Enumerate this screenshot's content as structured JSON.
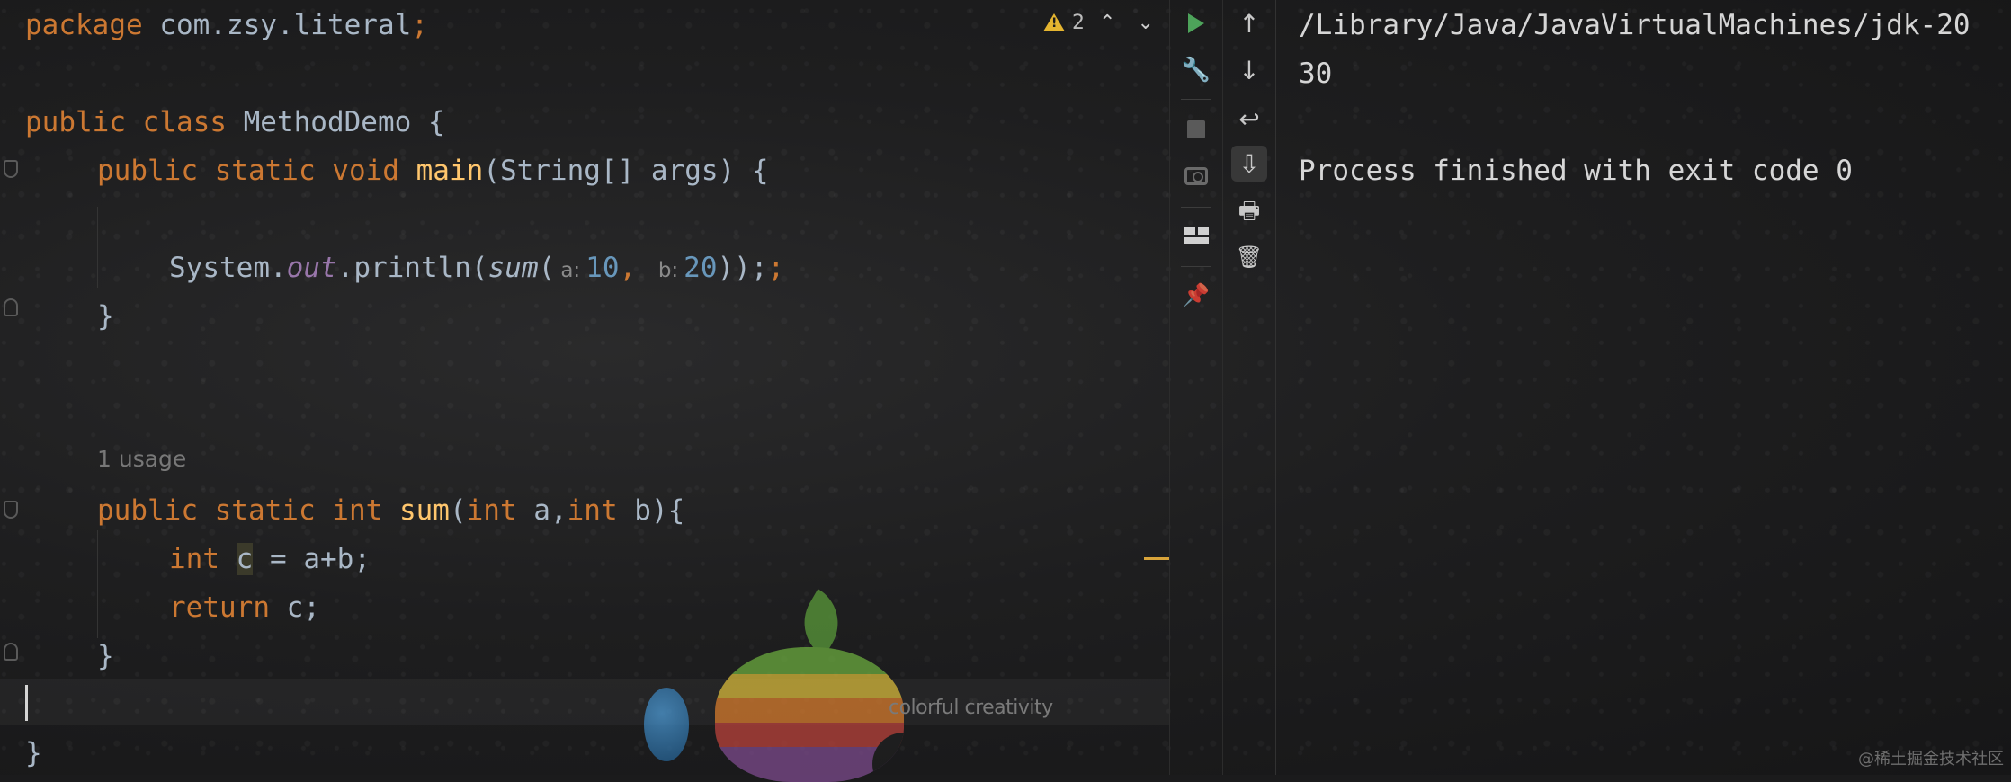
{
  "editor": {
    "package_kw": "package",
    "package_name": " com.zsy.literal",
    "package_semi": ";",
    "class_kw1": "public",
    "class_kw2": "class",
    "class_name": " MethodDemo {",
    "main_kw": "public static void",
    "main_fn": "main",
    "main_rest": "(String[] args) {",
    "print_prefix": "System.",
    "print_out": "out",
    "print_mid": ".println(",
    "print_sum": "sum",
    "print_paren": "(",
    "hint_a": "a:",
    "arg_a": "10",
    "comma": ", ",
    "hint_b": "b:",
    "arg_b": "20",
    "print_close": "));",
    "print_semi": ";",
    "close_main": "}",
    "usage_text": "1 usage",
    "sum_kw": "public static int",
    "sum_fn": "sum",
    "sum_p1": "(",
    "sum_p1_kw": "int",
    "sum_p1_name": " a,",
    "sum_p2_kw": "int",
    "sum_p2_name": " b){",
    "int_kw": "int",
    "var_c": "c",
    "assign": " = a+b;",
    "return_kw": "return",
    "return_rest": " c;",
    "close_sum": "}",
    "close_class": "}"
  },
  "inspection": {
    "warning_count": "2",
    "prev_label": "⌃",
    "next_label": "⌄"
  },
  "wallpaper": {
    "tagline": "colorful creativity"
  },
  "toolbar_left": {
    "rerun_icon": "play-icon",
    "wrench_glyph": "🔧",
    "pin_glyph": "📌"
  },
  "toolbar_right": {
    "up_glyph": "↑",
    "down_glyph": "↓",
    "wrap_glyph": "↩",
    "scroll_glyph": "⇩",
    "print_glyph": "🖶",
    "trash_glyph": "🗑"
  },
  "console": {
    "lines": [
      "/Library/Java/JavaVirtualMachines/jdk-20",
      "30",
      "",
      "Process finished with exit code 0"
    ]
  },
  "watermark": "@稀土掘金技术社区",
  "colors": {
    "keyword": "#cc7832",
    "function": "#ffc66d",
    "static_field": "#9876aa",
    "number": "#6897bb",
    "text": "#a9b7c6",
    "run_green": "#4da35a",
    "warning": "#e5b530"
  }
}
